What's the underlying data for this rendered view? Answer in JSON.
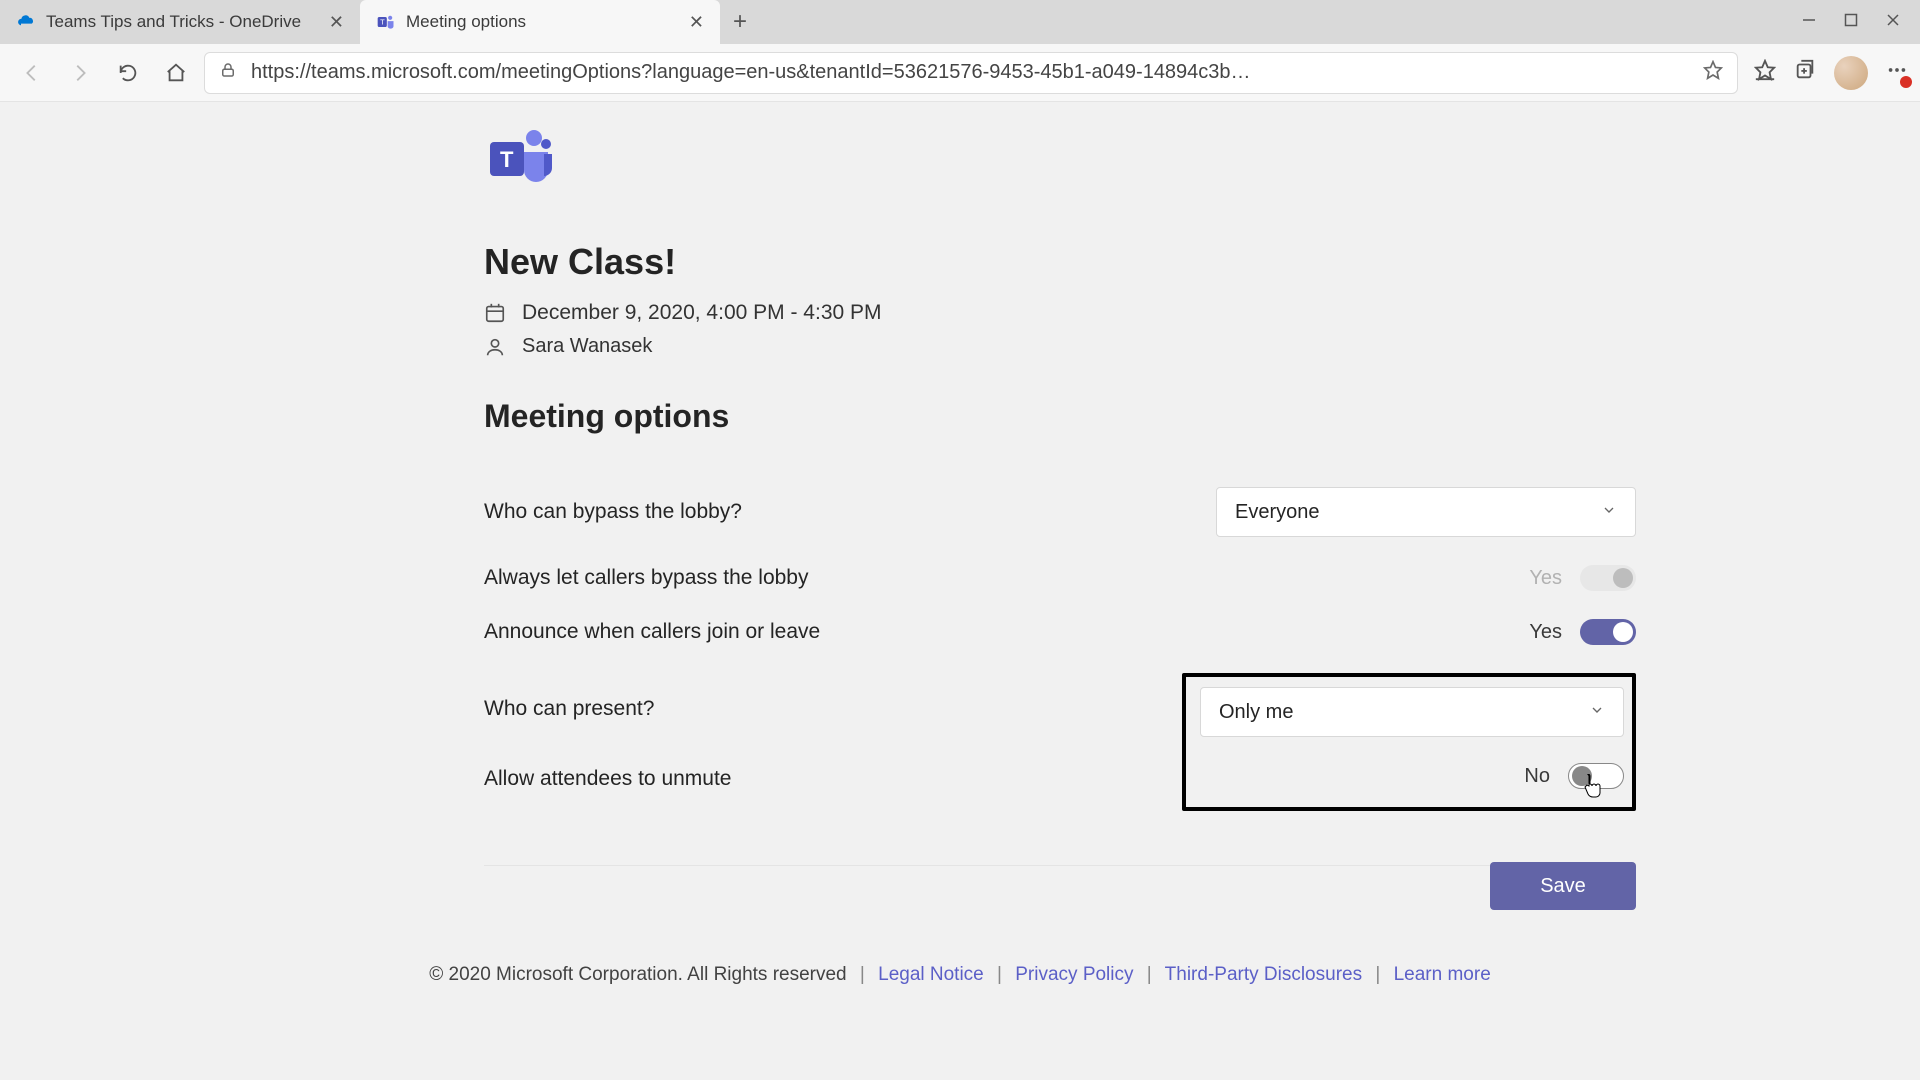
{
  "browser": {
    "tabs": [
      {
        "title": "Teams Tips and Tricks - OneDrive",
        "active": false
      },
      {
        "title": "Meeting options",
        "active": true
      }
    ],
    "url": "https://teams.microsoft.com/meetingOptions?language=en-us&tenantId=53621576-9453-45b1-a049-14894c3b…"
  },
  "header": {
    "meeting_name": "New Class!",
    "meeting_time": "December 9, 2020, 4:00 PM - 4:30 PM",
    "organizer": "Sara Wanasek"
  },
  "section_title": "Meeting options",
  "options": {
    "lobby_bypass_label": "Who can bypass the lobby?",
    "lobby_bypass_value": "Everyone",
    "callers_bypass_label": "Always let callers bypass the lobby",
    "callers_bypass_value": "Yes",
    "announce_label": "Announce when callers join or leave",
    "announce_value": "Yes",
    "present_label": "Who can present?",
    "present_value": "Only me",
    "unmute_label": "Allow attendees to unmute",
    "unmute_value": "No"
  },
  "buttons": {
    "save": "Save"
  },
  "footer": {
    "copyright": "© 2020 Microsoft Corporation. All Rights reserved",
    "legal": "Legal Notice",
    "privacy": "Privacy Policy",
    "third": "Third-Party Disclosures",
    "learn": "Learn more"
  }
}
